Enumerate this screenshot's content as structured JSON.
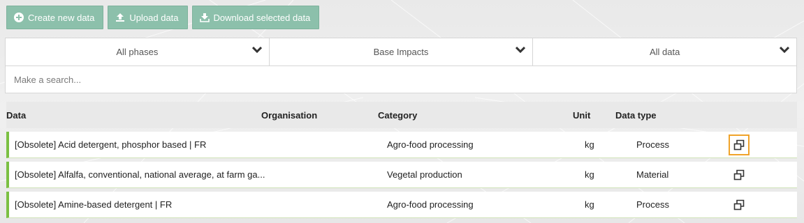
{
  "toolbar": {
    "create_label": "Create new data",
    "upload_label": "Upload data",
    "download_label": "Download selected data"
  },
  "filters": {
    "phase": "All phases",
    "impacts": "Base Impacts",
    "data_scope": "All data",
    "search_placeholder": "Make a search..."
  },
  "table": {
    "headers": {
      "data": "Data",
      "organisation": "Organisation",
      "category": "Category",
      "unit": "Unit",
      "data_type": "Data type"
    },
    "rows": [
      {
        "data": "[Obsolete] Acid detergent, phosphor based | FR",
        "category": "Agro-food processing",
        "unit": "kg",
        "type": "Process",
        "icon": "duplicate-icon"
      },
      {
        "data": "[Obsolete] Alfalfa, conventional, national average, at farm ga...",
        "category": "Vegetal production",
        "unit": "kg",
        "type": "Material",
        "icon": "duplicate-icon"
      },
      {
        "data": "[Obsolete] Amine-based detergent | FR",
        "category": "Agro-food processing",
        "unit": "kg",
        "type": "Process",
        "icon": "duplicate-icon"
      }
    ]
  },
  "colors": {
    "button": "#8cc0ab",
    "row_accent": "#7bc043",
    "focus": "#f0a32a"
  }
}
